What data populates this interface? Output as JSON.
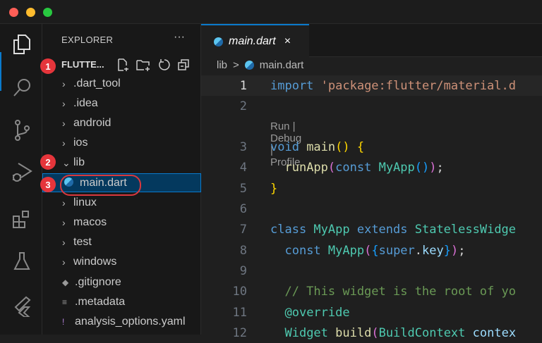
{
  "sidebar": {
    "title": "EXPLORER",
    "more": "···",
    "root": "FLUTTE...",
    "items": [
      {
        "label": ".dart_tool",
        "chev": "›"
      },
      {
        "label": ".idea",
        "chev": "›"
      },
      {
        "label": "android",
        "chev": "›"
      },
      {
        "label": "ios",
        "chev": "›"
      },
      {
        "label": "lib",
        "chev": "⌄"
      },
      {
        "label": "main.dart",
        "chev": ""
      },
      {
        "label": "linux",
        "chev": "›"
      },
      {
        "label": "macos",
        "chev": "›"
      },
      {
        "label": "test",
        "chev": "›"
      },
      {
        "label": "windows",
        "chev": "›"
      },
      {
        "label": ".gitignore",
        "chev": ""
      },
      {
        "label": ".metadata",
        "chev": ""
      },
      {
        "label": "analysis_options.yaml",
        "chev": ""
      }
    ]
  },
  "badges": [
    "1",
    "2",
    "3"
  ],
  "tab": {
    "label": "main.dart",
    "close": "×"
  },
  "breadcrumb": {
    "folder": "lib",
    "sep": ">",
    "file": "main.dart"
  },
  "codelens": "Run | Debug | Profile",
  "code": [
    {
      "n": "1",
      "t": [
        [
          "kw",
          "import "
        ],
        [
          "str",
          "'package:flutter/material.d"
        ]
      ]
    },
    {
      "n": "2",
      "t": []
    },
    {
      "n": "3",
      "t": [
        [
          "kw",
          "void "
        ],
        [
          "fn",
          "main"
        ],
        [
          "br1",
          "() {"
        ]
      ]
    },
    {
      "n": "4",
      "t": [
        [
          "pl",
          "  "
        ],
        [
          "fn",
          "runApp"
        ],
        [
          "br2",
          "("
        ],
        [
          "kw",
          "const "
        ],
        [
          "ty",
          "MyApp"
        ],
        [
          "br3",
          "()"
        ],
        [
          "br2",
          ")"
        ],
        [
          "pl",
          ";"
        ]
      ]
    },
    {
      "n": "5",
      "t": [
        [
          "br1",
          "}"
        ]
      ]
    },
    {
      "n": "6",
      "t": []
    },
    {
      "n": "7",
      "t": [
        [
          "kw",
          "class "
        ],
        [
          "ty",
          "MyApp "
        ],
        [
          "kw",
          "extends "
        ],
        [
          "ty",
          "StatelessWidge"
        ]
      ]
    },
    {
      "n": "8",
      "t": [
        [
          "pl",
          "  "
        ],
        [
          "kw",
          "const "
        ],
        [
          "ty",
          "MyApp"
        ],
        [
          "br2",
          "("
        ],
        [
          "br3",
          "{"
        ],
        [
          "kw",
          "super"
        ],
        [
          "pl",
          "."
        ],
        [
          "var",
          "key"
        ],
        [
          "br3",
          "}"
        ],
        [
          "br2",
          ")"
        ],
        [
          "pl",
          ";"
        ]
      ]
    },
    {
      "n": "9",
      "t": []
    },
    {
      "n": "10",
      "t": [
        [
          "cm",
          "  // This widget is the root of yo"
        ]
      ]
    },
    {
      "n": "11",
      "t": [
        [
          "pl",
          "  "
        ],
        [
          "ty",
          "@override"
        ]
      ]
    },
    {
      "n": "12",
      "t": [
        [
          "pl",
          "  "
        ],
        [
          "ty",
          "Widget "
        ],
        [
          "fn",
          "build"
        ],
        [
          "br2",
          "("
        ],
        [
          "ty",
          "BuildContext "
        ],
        [
          "var",
          "contex"
        ]
      ]
    }
  ]
}
